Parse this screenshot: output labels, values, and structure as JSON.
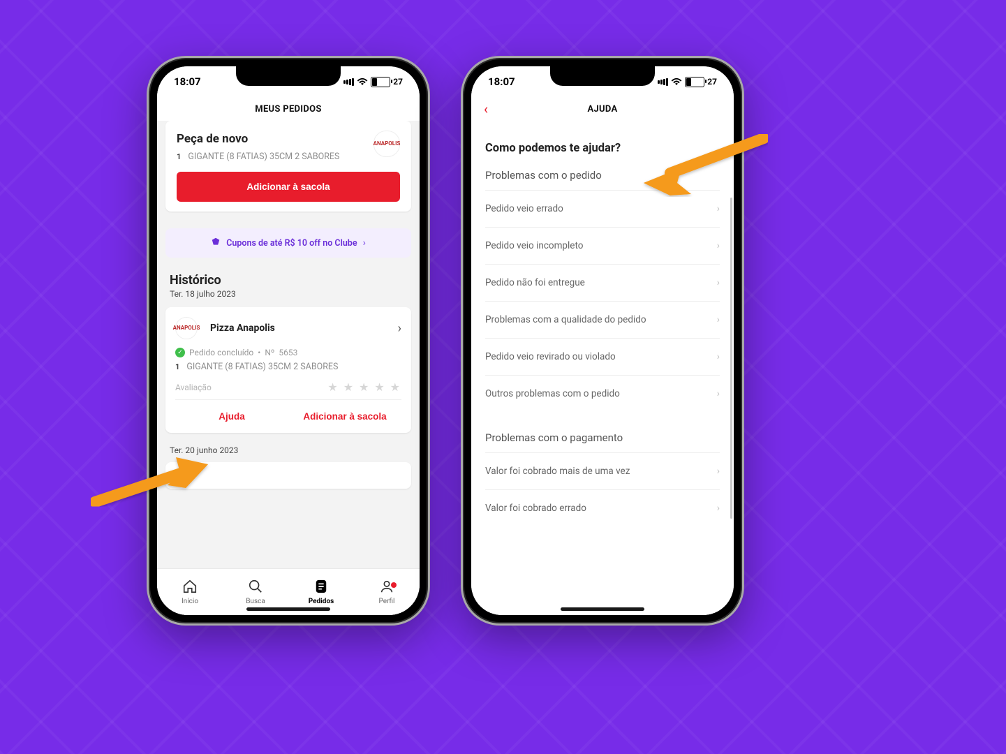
{
  "status": {
    "time": "18:07",
    "battery": "27"
  },
  "left": {
    "header_title": "MEUS PEDIDOS",
    "reorder": {
      "title": "Peça de novo",
      "logo": "ANAPOLIS",
      "qty": "1",
      "item": "GIGANTE (8 FATIAS) 35CM 2 SABORES",
      "button": "Adicionar à sacola"
    },
    "promo": "Cupons de até R$ 10 off no Clube",
    "history_title": "Histórico",
    "date1": "Ter. 18 julho 2023",
    "order1": {
      "store": "Pizza Anapolis",
      "status": "Pedido concluído",
      "number_label": "Nº",
      "number": "5653",
      "qty": "1",
      "item": "GIGANTE (8 FATIAS) 35CM 2 SABORES",
      "rating_label": "Avaliação",
      "ajuda": "Ajuda",
      "add": "Adicionar à sacola"
    },
    "date2": "Ter. 20 junho 2023",
    "tabs": {
      "inicio": "Início",
      "busca": "Busca",
      "pedidos": "Pedidos",
      "perfil": "Perfil"
    }
  },
  "right": {
    "header_title": "AJUDA",
    "heading": "Como podemos te ajudar?",
    "section1": "Problemas com o pedido",
    "items1": [
      "Pedido veio errado",
      "Pedido veio incompleto",
      "Pedido não foi entregue",
      "Problemas com a qualidade do pedido",
      "Pedido veio revirado ou violado",
      "Outros problemas com o pedido"
    ],
    "section2": "Problemas com o pagamento",
    "items2": [
      "Valor foi cobrado mais de uma vez",
      "Valor foi cobrado errado"
    ]
  }
}
